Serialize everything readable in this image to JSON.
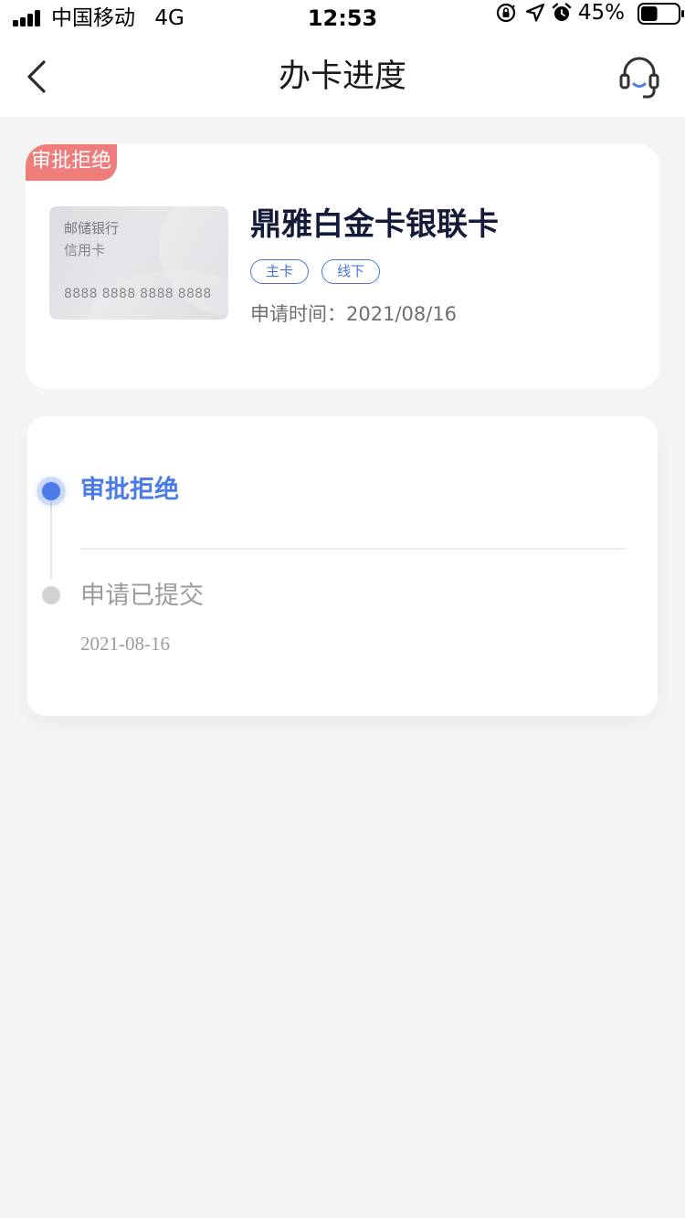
{
  "status_bar": {
    "carrier": "中国移动",
    "network": "4G",
    "time": "12:53",
    "battery_percent": "45%",
    "battery_level": 0.45,
    "icons": [
      "orientation-lock-icon",
      "location-icon",
      "alarm-icon",
      "battery-icon"
    ]
  },
  "nav": {
    "title": "办卡进度",
    "back_icon": "chevron-left-icon",
    "service_icon": "headset-icon"
  },
  "card": {
    "status_tag": "审批拒绝",
    "bank_name": "邮储银行",
    "card_type": "信用卡",
    "card_number": "8888 8888 8888 8888",
    "name": "鼎雅白金卡银联卡",
    "tags": [
      "主卡",
      "线下"
    ],
    "apply_time": "申请时间：2021/08/16"
  },
  "progress": {
    "steps": [
      {
        "label": "审批拒绝",
        "date": "",
        "active": true
      },
      {
        "label": "申请已提交",
        "date": "2021-08-16",
        "active": false
      }
    ]
  },
  "colors": {
    "accent": "#4a7be8",
    "tag_border": "#4a73d9",
    "reject_tag": "#ee7d7b",
    "page_background": "#f4f4f4",
    "title_text": "#141a3a"
  }
}
